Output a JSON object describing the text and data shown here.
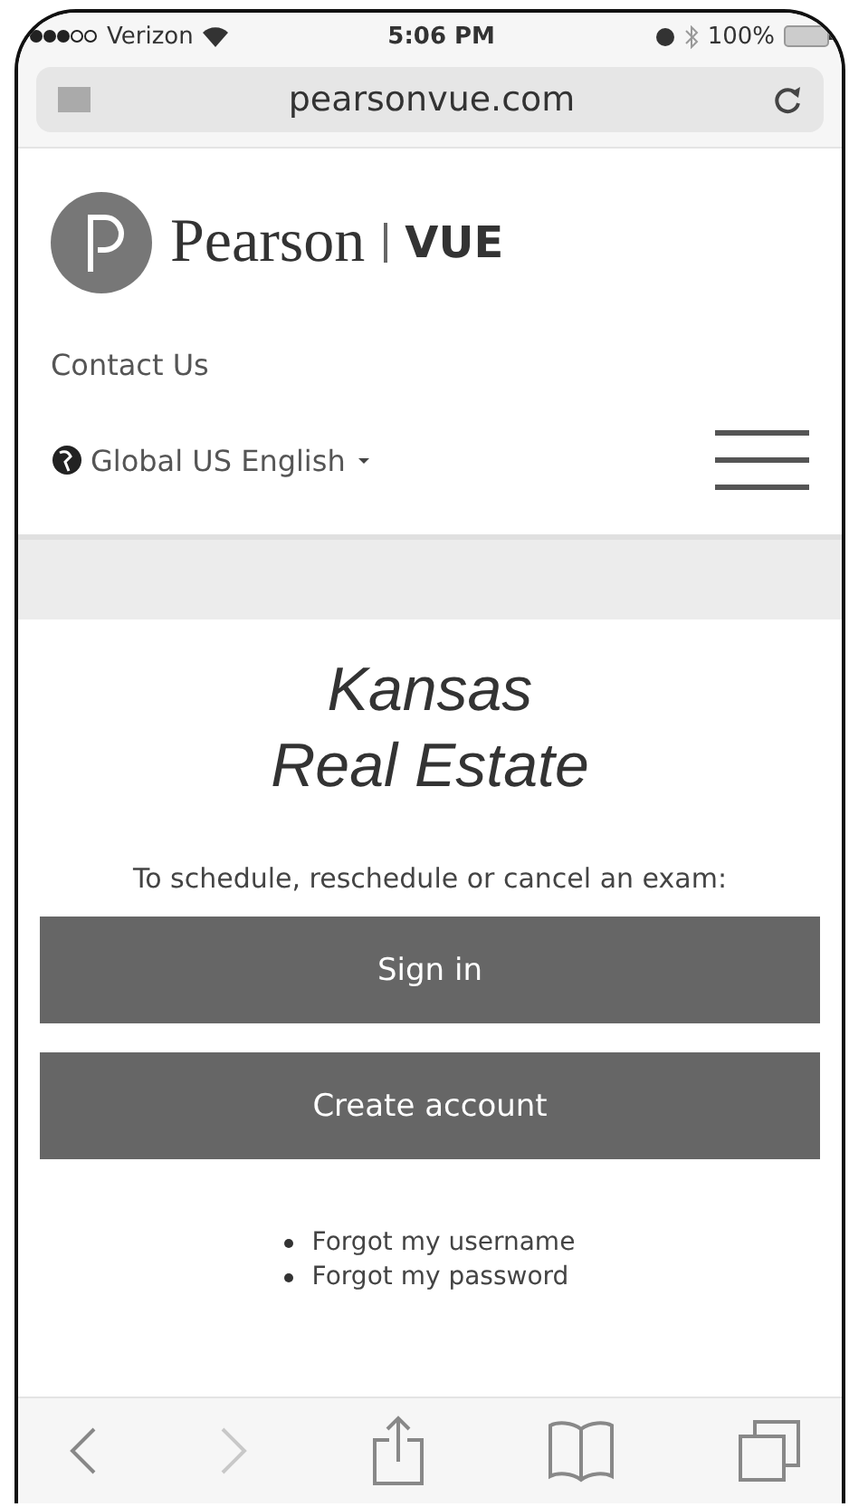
{
  "status_bar": {
    "carrier": "Verizon",
    "time": "5:06 PM",
    "battery": "100%"
  },
  "address_bar": {
    "url": "pearsonvue.com"
  },
  "header": {
    "logo_name": "Pearson",
    "logo_product": "VUE",
    "contact": "Contact Us",
    "language": "Global US English"
  },
  "title_lines": [
    "Kansas",
    "Real Estate"
  ],
  "intro": "To schedule, reschedule or cancel an exam:",
  "buttons": [
    "Sign in",
    "Create account"
  ],
  "links": [
    "Forgot my username",
    "Forgot my password"
  ],
  "toolbar": [
    {
      "kind": "back",
      "disabled": false
    },
    {
      "kind": "forward",
      "disabled": true
    },
    {
      "kind": "share",
      "disabled": false
    },
    {
      "kind": "bookmarks",
      "disabled": false
    },
    {
      "kind": "tabs",
      "disabled": false
    }
  ]
}
